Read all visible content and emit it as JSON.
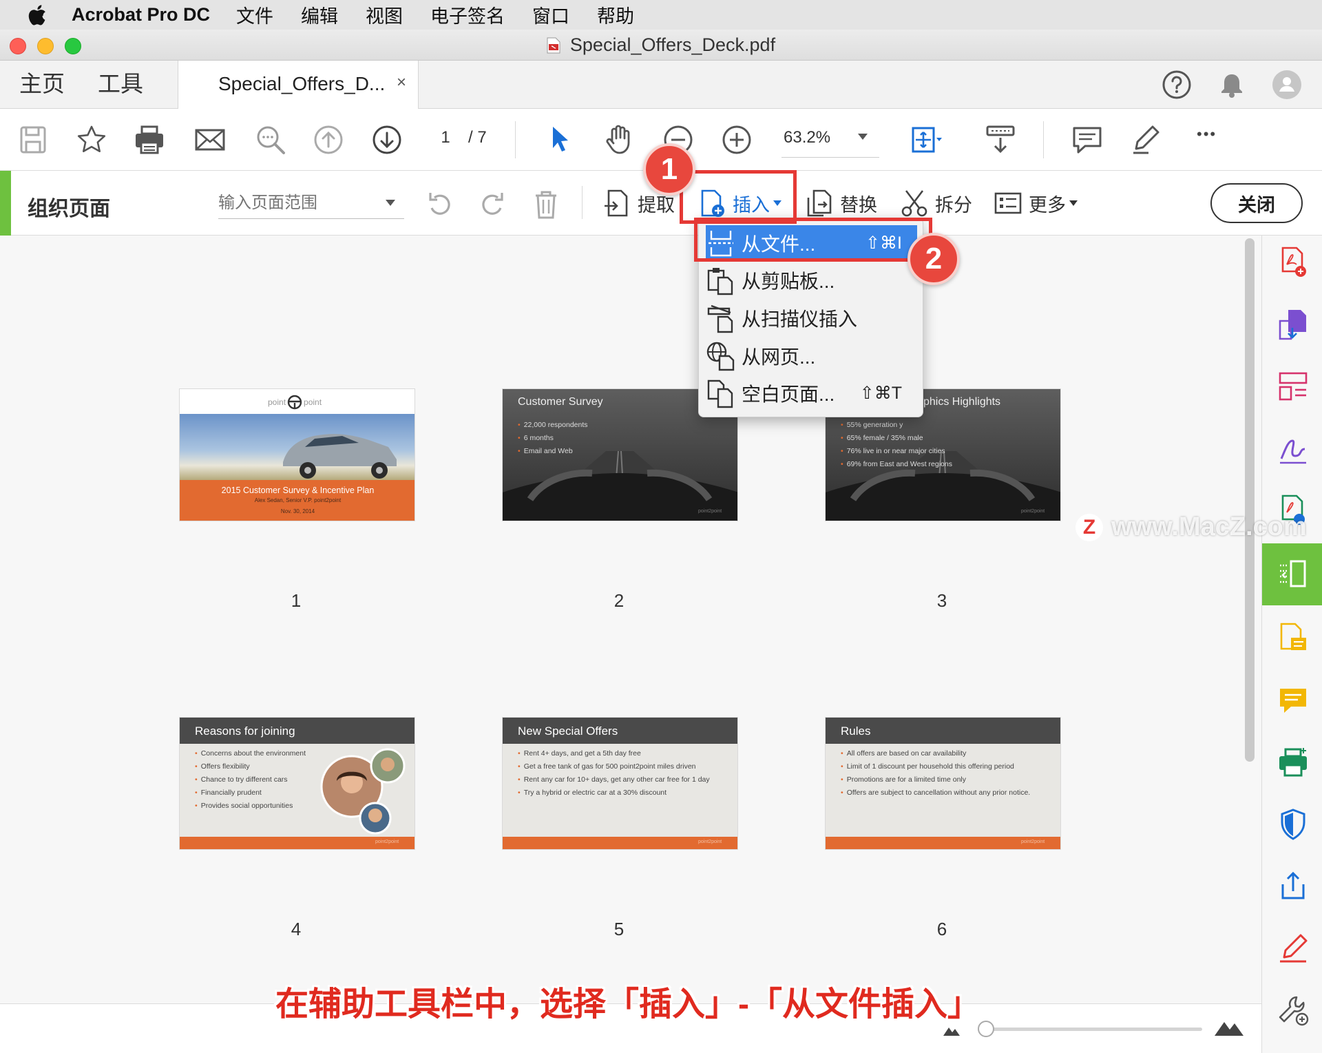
{
  "menubar": {
    "app_name": "Acrobat Pro DC",
    "items": [
      "文件",
      "编辑",
      "视图",
      "电子签名",
      "窗口",
      "帮助"
    ]
  },
  "window": {
    "title": "Special_Offers_Deck.pdf"
  },
  "tabs": {
    "home": "主页",
    "tools": "工具",
    "document": "Special_Offers_D...",
    "close_glyph": "×"
  },
  "toolbar": {
    "page_current": "1",
    "page_total": "/ 7",
    "zoom": "63.2%",
    "more_glyph": "•••"
  },
  "organize_bar": {
    "title": "组织页面",
    "range_placeholder": "输入页面范围",
    "extract": "提取",
    "insert": "插入",
    "replace": "替换",
    "split": "拆分",
    "more": "更多",
    "close": "关闭"
  },
  "insert_menu": {
    "items": [
      {
        "label": "从文件...",
        "shortcut": "⇧⌘I",
        "icon": "insert-from-file-icon"
      },
      {
        "label": "从剪贴板...",
        "shortcut": "",
        "icon": "insert-from-clipboard-icon"
      },
      {
        "label": "从扫描仪插入",
        "shortcut": "",
        "icon": "insert-from-scanner-icon"
      },
      {
        "label": "从网页...",
        "shortcut": "",
        "icon": "insert-from-web-icon"
      },
      {
        "label": "空白页面...",
        "shortcut": "⇧⌘T",
        "icon": "insert-blank-page-icon"
      }
    ]
  },
  "annotations": {
    "step1": "1",
    "step2": "2",
    "caption": "在辅助工具栏中，选择「插入」-「从文件插入」",
    "watermark": "www.MacZ.com",
    "watermark_logo": "Z"
  },
  "pages": [
    {
      "number": "1",
      "logo_left": "point",
      "logo_right": "point",
      "title": "2015 Customer Survey & Incentive Plan",
      "subtitle": "Alex Sedan, Senior V.P. point2point",
      "date": "Nov. 30, 2014"
    },
    {
      "number": "2",
      "title": "Customer Survey",
      "bullets": [
        "22,000 respondents",
        "6 months",
        "Email and Web"
      ],
      "footer_brand": "point2point"
    },
    {
      "number": "3",
      "title": "phics Highlights",
      "bullets": [
        "55% generation y",
        "65% female / 35% male",
        "76% live in or near major cities",
        "69% from East and West regions"
      ],
      "footer_brand": "point2point"
    },
    {
      "number": "4",
      "title": "Reasons for joining",
      "bullets": [
        "Concerns about the environment",
        "Offers flexibility",
        "Chance to try different cars",
        "Financially prudent",
        "Provides social opportunities"
      ],
      "footer_brand": "point2point"
    },
    {
      "number": "5",
      "title": "New Special Offers",
      "bullets": [
        "Rent 4+ days, and get a 5th day free",
        "Get a free tank of gas for 500 point2point miles driven",
        "Rent any car for 10+ days, get any other car free for 1 day",
        "Try a hybrid or electric car at a 30% discount"
      ],
      "footer_brand": "point2point"
    },
    {
      "number": "6",
      "title": "Rules",
      "bullets": [
        "All offers are based on car availability",
        "Limit of 1 discount per household this offering period",
        "Promotions are for a limited time only",
        "Offers are subject to cancellation without any prior notice."
      ],
      "footer_brand": "point2point"
    }
  ],
  "colors": {
    "accent_green": "#6ec13f",
    "menu_highlight": "#3a86e8",
    "annotation_red": "#e53935",
    "slide_orange": "#e26a30"
  }
}
